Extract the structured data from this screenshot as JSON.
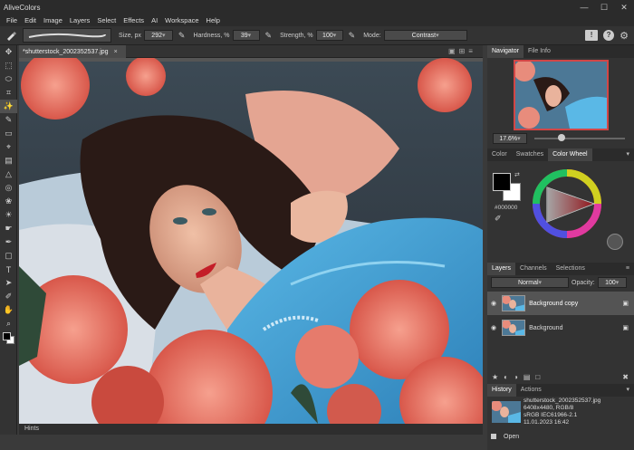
{
  "app": {
    "title": "AliveColors",
    "win_min": "—",
    "win_max": "☐",
    "win_close": "✕"
  },
  "menu": [
    "File",
    "Edit",
    "Image",
    "Layers",
    "Select",
    "Effects",
    "AI",
    "Workspace",
    "Help"
  ],
  "options": {
    "size_label": "Size, px",
    "size_value": "292",
    "hardness_label": "Hardness, %",
    "hardness_value": "39",
    "strength_label": "Strength, %",
    "strength_value": "100",
    "mode_label": "Mode:",
    "mode_value": "Contrast"
  },
  "document": {
    "tab_label": "*shutterstock_2002352537.jpg",
    "tab_close": "×",
    "hints_label": "Hints"
  },
  "navigator": {
    "tabs": [
      "Navigator",
      "File Info"
    ],
    "zoom": "17.6%"
  },
  "color": {
    "tabs": [
      "Color",
      "Swatches",
      "Color Wheel"
    ],
    "hex": "#000000",
    "foreground": "#000000",
    "background": "#ffffff"
  },
  "layers": {
    "tabs": [
      "Layers",
      "Channels",
      "Selections"
    ],
    "blend_mode": "Normal",
    "opacity_label": "Opacity:",
    "opacity_value": "100",
    "items": [
      {
        "name": "Background copy"
      },
      {
        "name": "Background"
      }
    ]
  },
  "history": {
    "tabs": [
      "History",
      "Actions"
    ],
    "file_name": "shutterstock_2002352537.jpg",
    "dims": "6408x4480, RGB/8",
    "profile": "sRGB IEC61966-2.1",
    "date": "11.01.2023 16:42",
    "step": "Open"
  }
}
